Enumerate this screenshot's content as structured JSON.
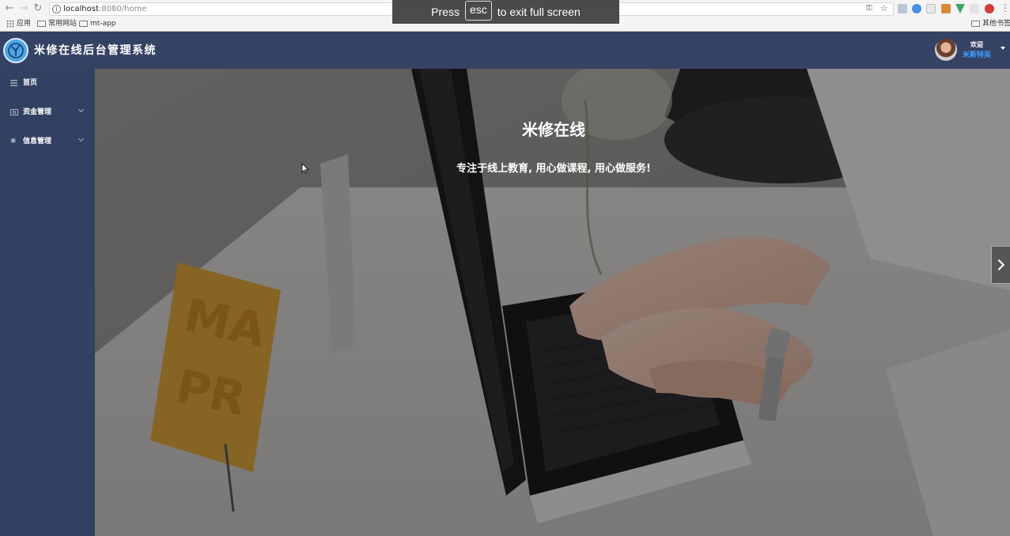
{
  "browser": {
    "url_host": "localhost",
    "url_rest": ":8080/home",
    "bookmarks": [
      {
        "label": "应用",
        "icon": "apps-grid-icon"
      },
      {
        "label": "常用网站",
        "icon": "folder-icon"
      },
      {
        "label": "mt-app",
        "icon": "folder-icon"
      }
    ],
    "other_bookmarks": "其他书签"
  },
  "fullscreen_toast": {
    "pre": "Press",
    "key": "esc",
    "post": "to exit full screen"
  },
  "header": {
    "title": "米修在线后台管理系统",
    "welcome": "欢迎",
    "username": "米斯特吴"
  },
  "sidebar": {
    "items": [
      {
        "label": "首页",
        "icon": "list-icon",
        "expandable": false
      },
      {
        "label": "资金管理",
        "icon": "wallet-icon",
        "expandable": true
      },
      {
        "label": "信息管理",
        "icon": "gear-icon",
        "expandable": true
      }
    ]
  },
  "banner": {
    "title": "米修在线",
    "subtitle": "专注于线上教育, 用心做课程, 用心做服务!"
  },
  "colors": {
    "header_bg": "#344264",
    "sidebar_bg": "#324061",
    "username": "#409eff"
  }
}
